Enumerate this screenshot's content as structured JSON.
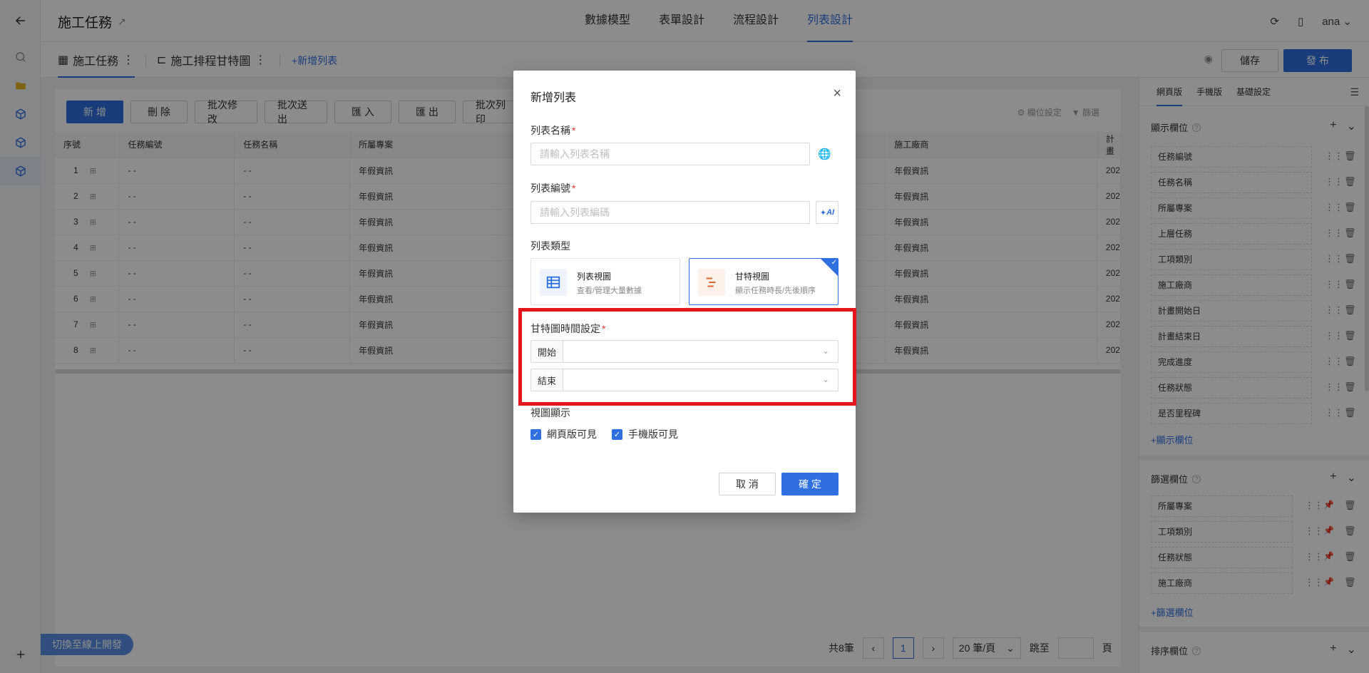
{
  "header": {
    "app_title": "施工任務",
    "tabs": [
      "數據模型",
      "表單設計",
      "流程設計",
      "列表設計"
    ],
    "user": "ana"
  },
  "subbar": {
    "list_tab_1": "施工任務",
    "list_tab_2": "施工排程甘特圖",
    "add_list": "+新增列表",
    "save": "儲存",
    "publish": "發 布"
  },
  "toolbar": {
    "buttons": [
      "新 增",
      "刪 除",
      "批次修改",
      "批次送出",
      "匯 入",
      "匯 出",
      "批次列印"
    ],
    "field_settings": "欄位設定",
    "filter": "篩選"
  },
  "table": {
    "columns": [
      "序號",
      "任務編號",
      "任務名稱",
      "所屬專案",
      "施工廠商",
      "計畫"
    ],
    "rows": [
      {
        "no": "1",
        "code": "- -",
        "name": "- -",
        "project": "年假資訊",
        "vendor": "年假資訊",
        "plan": "202"
      },
      {
        "no": "2",
        "code": "- -",
        "name": "- -",
        "project": "年假資訊",
        "vendor": "年假資訊",
        "plan": "202"
      },
      {
        "no": "3",
        "code": "- -",
        "name": "- -",
        "project": "年假資訊",
        "vendor": "年假資訊",
        "plan": "202"
      },
      {
        "no": "4",
        "code": "- -",
        "name": "- -",
        "project": "年假資訊",
        "vendor": "年假資訊",
        "plan": "202"
      },
      {
        "no": "5",
        "code": "- -",
        "name": "- -",
        "project": "年假資訊",
        "vendor": "年假資訊",
        "plan": "202"
      },
      {
        "no": "6",
        "code": "- -",
        "name": "- -",
        "project": "年假資訊",
        "vendor": "年假資訊",
        "plan": "202"
      },
      {
        "no": "7",
        "code": "- -",
        "name": "- -",
        "project": "年假資訊",
        "vendor": "年假資訊",
        "plan": "202"
      },
      {
        "no": "8",
        "code": "- -",
        "name": "- -",
        "project": "年假資訊",
        "vendor": "年假資訊",
        "plan": "202"
      }
    ]
  },
  "pager": {
    "total": "共8筆",
    "current": "1",
    "size": "20 筆/頁",
    "jump": "跳至",
    "page": "頁"
  },
  "switch_online": "切換至線上開發",
  "right_panel": {
    "tabs": [
      "網頁版",
      "手機版",
      "基礎設定"
    ],
    "display_title": "顯示欄位",
    "display_fields": [
      "任務編號",
      "任務名稱",
      "所屬專案",
      "上層任務",
      "工項類別",
      "施工廠商",
      "計畫開始日",
      "計畫結束日",
      "完成進度",
      "任務狀態",
      "是否里程碑"
    ],
    "add_display": "+顯示欄位",
    "filter_title": "篩選欄位",
    "filter_fields": [
      "所屬專案",
      "工項類別",
      "任務狀態",
      "施工廠商"
    ],
    "add_filter": "+篩選欄位",
    "sort_title": "排序欄位"
  },
  "dialog": {
    "title": "新增列表",
    "name_label": "列表名稱",
    "name_placeholder": "請輸入列表名稱",
    "code_label": "列表編號",
    "code_placeholder": "請輸入列表編碼",
    "ai_label": "AI",
    "type_label": "列表類型",
    "type_list_name": "列表視圖",
    "type_list_desc": "查看/管理大量數據",
    "type_gantt_name": "甘特視圖",
    "type_gantt_desc": "顯示任務時長/先後順序",
    "gantt_time_label": "甘特圖時間設定",
    "start_label": "開始",
    "end_label": "結束",
    "view_label": "視圖顯示",
    "web_visible": "網頁版可見",
    "mobile_visible": "手機版可見",
    "cancel": "取 消",
    "ok": "確 定"
  },
  "colors": {
    "accent": "#2f6fe0",
    "highlight_box": "#e3161c",
    "required": "#e03535"
  }
}
